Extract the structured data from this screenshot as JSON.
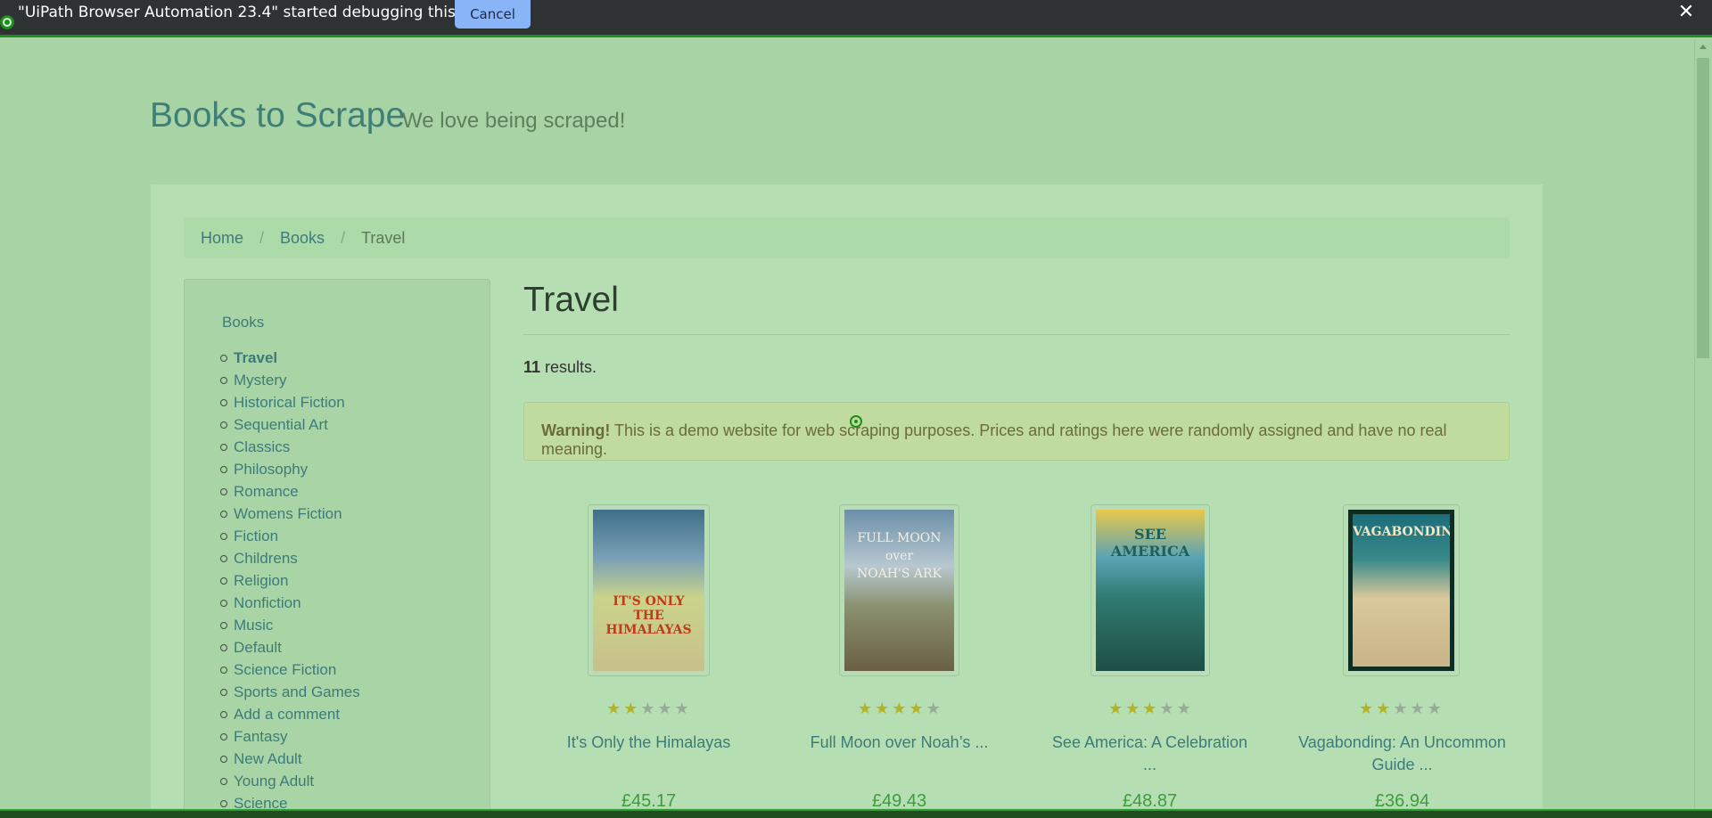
{
  "debug_bar": {
    "message": "\"UiPath Browser Automation 23.4\" started debugging this browser",
    "cancel_label": "Cancel",
    "close_glyph": "✕"
  },
  "header": {
    "brand": "Books to Scrape",
    "tagline": "We love being scraped!"
  },
  "breadcrumb": {
    "items": [
      {
        "label": "Home"
      },
      {
        "label": "Books"
      },
      {
        "label": "Travel"
      }
    ],
    "separator": "/"
  },
  "sidebar": {
    "heading": "Books",
    "categories": [
      {
        "label": "Travel",
        "active": true
      },
      {
        "label": "Mystery"
      },
      {
        "label": "Historical Fiction"
      },
      {
        "label": "Sequential Art"
      },
      {
        "label": "Classics"
      },
      {
        "label": "Philosophy"
      },
      {
        "label": "Romance"
      },
      {
        "label": "Womens Fiction"
      },
      {
        "label": "Fiction"
      },
      {
        "label": "Childrens"
      },
      {
        "label": "Religion"
      },
      {
        "label": "Nonfiction"
      },
      {
        "label": "Music"
      },
      {
        "label": "Default"
      },
      {
        "label": "Science Fiction"
      },
      {
        "label": "Sports and Games"
      },
      {
        "label": "Add a comment"
      },
      {
        "label": "Fantasy"
      },
      {
        "label": "New Adult"
      },
      {
        "label": "Young Adult"
      },
      {
        "label": "Science"
      }
    ]
  },
  "main": {
    "title": "Travel",
    "results_count": "11",
    "results_suffix": " results.",
    "warning_strong": "Warning!",
    "warning_text": " This is a demo website for web scraping purposes. Prices and ratings here were randomly assigned and have no real meaning."
  },
  "products": [
    {
      "title": "It's Only the Himalayas",
      "price": "£45.17",
      "rating": 2,
      "cover_text": "IT'S ONLY THE HIMALAYAS"
    },
    {
      "title": "Full Moon over Noah’s ...",
      "price": "£49.43",
      "rating": 4,
      "cover_text": "FULL MOON OVER NOAH'S ARK"
    },
    {
      "title": "See America: A Celebration ...",
      "price": "£48.87",
      "rating": 3,
      "cover_text": "SEE AMERICA"
    },
    {
      "title": "Vagabonding: An Uncommon Guide ...",
      "price": "£36.94",
      "rating": 2,
      "cover_text": "VAGABONDING"
    }
  ],
  "colors": {
    "star_on": "#b3b324",
    "star_off": "#9aaa9a",
    "link": "#3d7b7a",
    "price": "#3e9b3e"
  }
}
